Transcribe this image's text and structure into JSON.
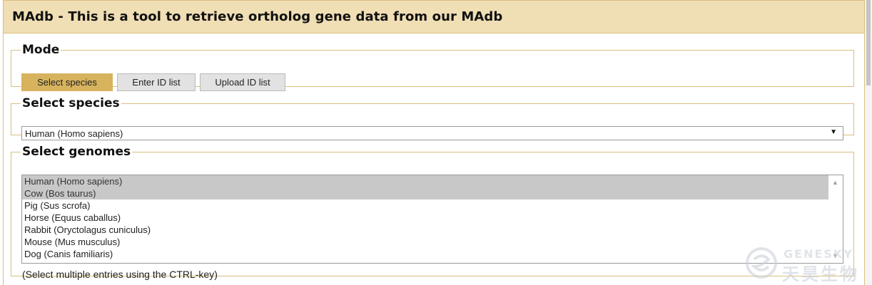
{
  "header": {
    "title": "MAdb - This is a tool to retrieve ortholog gene data from our MAdb"
  },
  "mode": {
    "legend": "Mode",
    "buttons": [
      "Select species",
      "Enter ID list",
      "Upload ID list"
    ],
    "active": "Select species"
  },
  "species": {
    "legend": "Select species",
    "selected": "Human (Homo sapiens)"
  },
  "genomes": {
    "legend": "Select genomes",
    "items": [
      {
        "label": "Human (Homo sapiens)",
        "selected": true
      },
      {
        "label": "Cow (Bos taurus)",
        "selected": true
      },
      {
        "label": "Pig (Sus scrofa)",
        "selected": false
      },
      {
        "label": "Horse (Equus caballus)",
        "selected": false
      },
      {
        "label": "Rabbit (Oryctolagus cuniculus)",
        "selected": false
      },
      {
        "label": "Mouse (Mus musculus)",
        "selected": false
      },
      {
        "label": "Dog (Canis familiaris)",
        "selected": false
      }
    ],
    "hint": "(Select multiple entries using the CTRL-key)"
  },
  "watermark": {
    "en": "GENESKY",
    "cn": "天昊生物"
  },
  "colors": {
    "accent": "#d7b35e",
    "header_bg": "#f0deb4",
    "border": "#d9bf7f",
    "selected_item": "#c8c8c8"
  },
  "icons": {
    "dropdown": "chevron-down-icon",
    "scroll_up": "scroll-up-arrow-icon",
    "scroll_down": "scroll-down-arrow-icon",
    "watermark_logo": "genesky-logo-icon"
  }
}
